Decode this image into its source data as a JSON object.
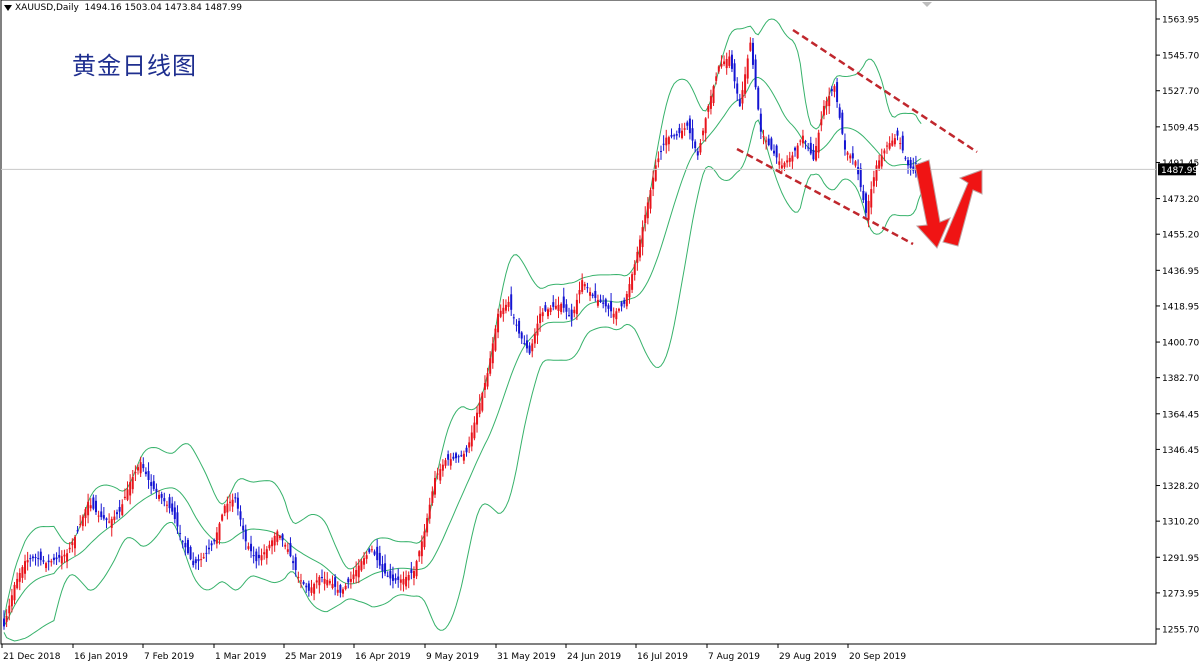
{
  "header": {
    "symbol": "XAUUSD,Daily",
    "ohlc": "1494.16 1503.04 1473.84 1487.99"
  },
  "annotation_title": "黄金日线图",
  "colors": {
    "bull": "#e8141c",
    "bear": "#1414d2",
    "band": "#37b26b",
    "channel": "#c0272d",
    "arrow": "#f01414",
    "current_price_bg": "#000000"
  },
  "chart_data": {
    "type": "candlestick",
    "symbol": "XAUUSD",
    "timeframe": "Daily",
    "title": "黄金日线图",
    "current_price": "1487.99",
    "ylim": [
      1250,
      1570
    ],
    "yticks": [
      "1563.95",
      "1545.70",
      "1527.70",
      "1509.45",
      "1491.45",
      "1473.20",
      "1455.20",
      "1436.95",
      "1418.95",
      "1400.70",
      "1382.70",
      "1364.45",
      "1346.45",
      "1328.20",
      "1310.20",
      "1291.95",
      "1273.95",
      "1255.70"
    ],
    "xticks": [
      "21 Dec 2018",
      "16 Jan 2019",
      "7 Feb 2019",
      "1 Mar 2019",
      "25 Mar 2019",
      "16 Apr 2019",
      "9 May 2019",
      "31 May 2019",
      "24 Jun 2019",
      "16 Jul 2019",
      "7 Aug 2019",
      "29 Aug 2019",
      "20 Sep 2019"
    ],
    "indicators": [
      "Bollinger Bands"
    ],
    "close_anchors": [
      [
        0,
        1257
      ],
      [
        4,
        1278
      ],
      [
        8,
        1290
      ],
      [
        12,
        1292
      ],
      [
        16,
        1289
      ],
      [
        20,
        1291
      ],
      [
        24,
        1294
      ],
      [
        28,
        1305
      ],
      [
        32,
        1320
      ],
      [
        36,
        1313
      ],
      [
        40,
        1310
      ],
      [
        44,
        1315
      ],
      [
        48,
        1330
      ],
      [
        52,
        1340
      ],
      [
        56,
        1328
      ],
      [
        60,
        1322
      ],
      [
        64,
        1315
      ],
      [
        68,
        1300
      ],
      [
        72,
        1288
      ],
      [
        76,
        1292
      ],
      [
        80,
        1300
      ],
      [
        84,
        1318
      ],
      [
        88,
        1322
      ],
      [
        92,
        1300
      ],
      [
        96,
        1290
      ],
      [
        100,
        1296
      ],
      [
        104,
        1305
      ],
      [
        108,
        1296
      ],
      [
        112,
        1282
      ],
      [
        116,
        1275
      ],
      [
        120,
        1282
      ],
      [
        124,
        1280
      ],
      [
        128,
        1274
      ],
      [
        132,
        1281
      ],
      [
        136,
        1290
      ],
      [
        140,
        1296
      ],
      [
        144,
        1285
      ],
      [
        148,
        1280
      ],
      [
        152,
        1281
      ],
      [
        156,
        1285
      ],
      [
        160,
        1305
      ],
      [
        164,
        1332
      ],
      [
        168,
        1341
      ],
      [
        172,
        1342
      ],
      [
        176,
        1345
      ],
      [
        180,
        1365
      ],
      [
        184,
        1385
      ],
      [
        188,
        1415
      ],
      [
        192,
        1421
      ],
      [
        196,
        1405
      ],
      [
        200,
        1395
      ],
      [
        204,
        1415
      ],
      [
        208,
        1418
      ],
      [
        212,
        1420
      ],
      [
        216,
        1412
      ],
      [
        220,
        1432
      ],
      [
        224,
        1424
      ],
      [
        228,
        1420
      ],
      [
        232,
        1415
      ],
      [
        236,
        1420
      ],
      [
        240,
        1440
      ],
      [
        244,
        1465
      ],
      [
        248,
        1490
      ],
      [
        252,
        1504
      ],
      [
        256,
        1505
      ],
      [
        260,
        1510
      ],
      [
        264,
        1495
      ],
      [
        268,
        1520
      ],
      [
        272,
        1540
      ],
      [
        276,
        1545
      ],
      [
        280,
        1520
      ],
      [
        284,
        1552
      ],
      [
        288,
        1507
      ],
      [
        292,
        1498
      ],
      [
        296,
        1490
      ],
      [
        300,
        1495
      ],
      [
        304,
        1505
      ],
      [
        308,
        1493
      ],
      [
        312,
        1520
      ],
      [
        316,
        1530
      ],
      [
        320,
        1498
      ],
      [
        324,
        1492
      ],
      [
        328,
        1466
      ],
      [
        332,
        1490
      ],
      [
        336,
        1500
      ],
      [
        340,
        1505
      ],
      [
        344,
        1490
      ],
      [
        347,
        1486
      ],
      [
        349,
        1488
      ]
    ],
    "annotations": [
      "descending channel",
      "down arrow",
      "up arrow"
    ]
  }
}
